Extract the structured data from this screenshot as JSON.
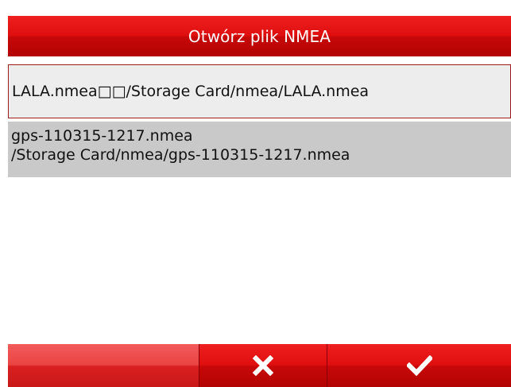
{
  "dialog": {
    "title": "Otwórz plik NMEA"
  },
  "path_field": {
    "value": "LALA.nmea□□/Storage Card/nmea/LALA.nmea"
  },
  "file_list": {
    "items": [
      {
        "name": "gps-110315-1217.nmea",
        "path": "/Storage Card/nmea/gps-110315-1217.nmea",
        "selected": true
      }
    ]
  },
  "toolbar": {
    "buttons": [
      {
        "icon": "empty",
        "label": ""
      },
      {
        "icon": "close-icon",
        "label": ""
      },
      {
        "icon": "checkmark-icon",
        "label": ""
      }
    ]
  },
  "colors": {
    "accent": "#e00f0f",
    "selected_row": "#c9c9c9",
    "field_background": "#ededed"
  }
}
